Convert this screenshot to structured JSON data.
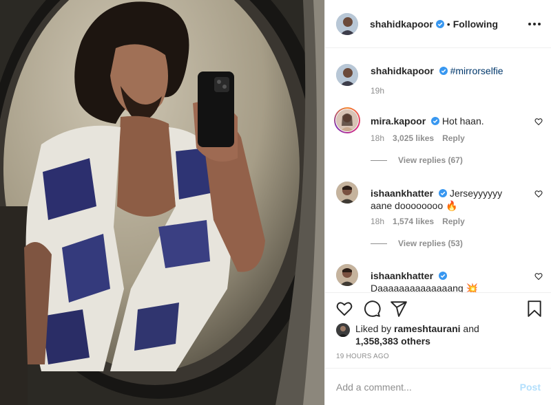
{
  "post": {
    "author": "shahidkapoor",
    "dot": "•",
    "follow_status": "Following",
    "caption_hashtag": "#mirrorselfie",
    "caption_time": "19h",
    "timestamp": "19 HOURS AGO"
  },
  "comments": [
    {
      "username": "mira.kapoor",
      "text": "Hot haan.",
      "time": "18h",
      "likes": "3,025 likes",
      "reply": "Reply",
      "view_replies": "View replies (67)"
    },
    {
      "username": "ishaankhatter",
      "text": "Jerseyyyyyy aane doooooooo 🔥",
      "time": "18h",
      "likes": "1,574 likes",
      "reply": "Reply",
      "view_replies": "View replies (53)"
    },
    {
      "username": "ishaankhatter",
      "text": "Daaaaaaaaaaaaaang 💥"
    }
  ],
  "likes": {
    "prefix": "Liked by",
    "user": "rameshtaurani",
    "and": "and",
    "count": "1,358,383 others"
  },
  "add_comment": {
    "placeholder": "Add a comment...",
    "post_label": "Post"
  },
  "icons": {
    "more": "more-icon",
    "heart": "heart-icon",
    "comment": "comment-icon",
    "share": "share-icon",
    "save": "bookmark-icon",
    "verified": "verified-badge-icon"
  },
  "colors": {
    "verified": "#3897f0",
    "link": "#00376b",
    "muted": "#8e8e8e",
    "post_disabled": "#b2dffc",
    "border": "#efefef"
  }
}
